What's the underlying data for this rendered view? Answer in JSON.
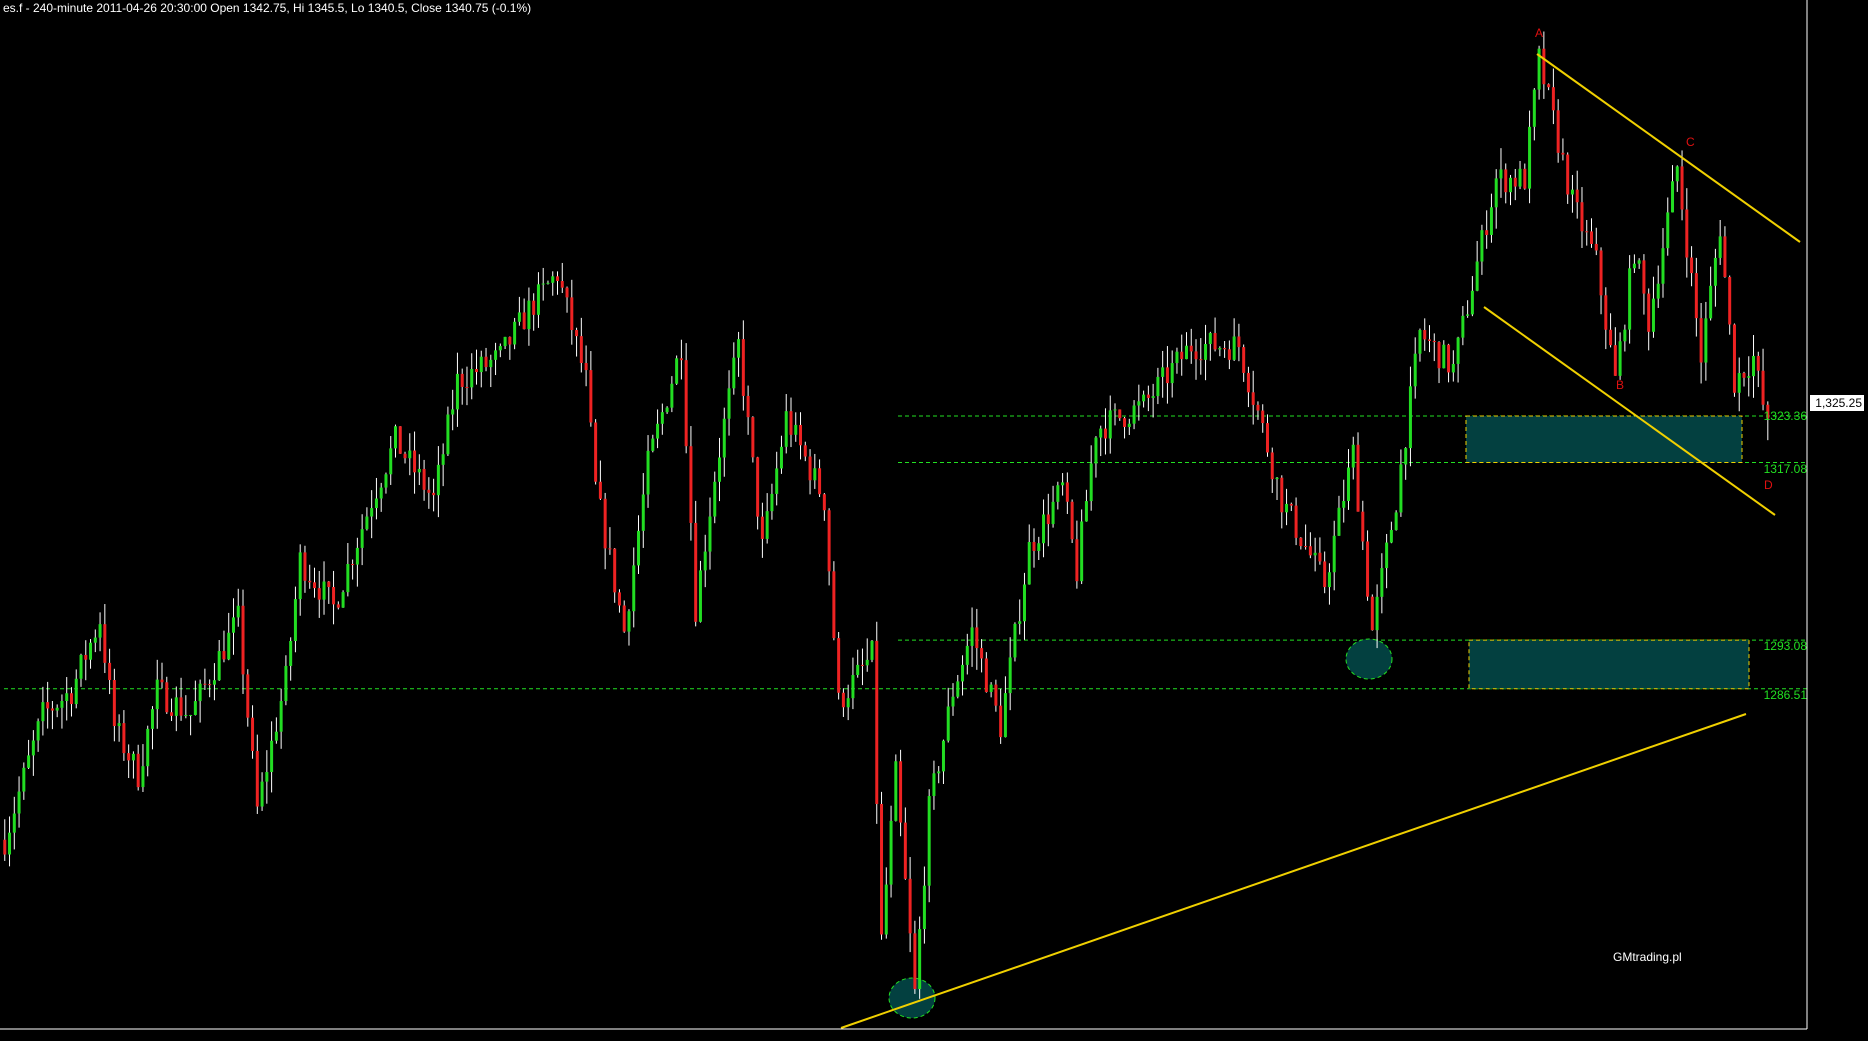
{
  "header": {
    "title": "es.f - 240-minute 2011-04-26 20:30:00 Open 1342.75, Hi 1345.5, Lo 1340.5, Close 1340.75 (-0.1%)"
  },
  "watermark": "GMtrading.pl",
  "last_price": "1,325.25",
  "colors": {
    "up": "#22dd22",
    "down": "#ee2222",
    "wick": "#ffffff",
    "trendline": "#f0d000",
    "level": "#22e022",
    "zone": "#034040"
  },
  "chart_data": {
    "type": "candlestick",
    "symbol": "es.f",
    "interval": "240-minute",
    "ylim": [
      1244,
      1373
    ],
    "levels": [
      {
        "label": "1323.36",
        "value": 1323.36
      },
      {
        "label": "1317.08",
        "value": 1317.08
      },
      {
        "label": "1293.08",
        "value": 1293.08
      },
      {
        "label": "1286.51",
        "value": 1286.51
      }
    ],
    "wave_labels": [
      {
        "text": "A",
        "bar": 323,
        "price": 1375
      },
      {
        "text": "B",
        "bar": 340,
        "price": 1323
      },
      {
        "text": "C",
        "bar": 355,
        "price": 1361
      },
      {
        "text": "D",
        "bar": 371,
        "price": 1310
      }
    ],
    "path": [
      [
        1,
        1266.1
      ],
      [
        9,
        1283
      ],
      [
        15,
        1286.2
      ],
      [
        21,
        1295.9
      ],
      [
        24,
        1281.4
      ],
      [
        29,
        1274.9
      ],
      [
        33,
        1286.2
      ],
      [
        40,
        1283
      ],
      [
        50,
        1295.9
      ],
      [
        54,
        1270.1
      ],
      [
        60,
        1287.8
      ],
      [
        63,
        1303.9
      ],
      [
        70,
        1297.5
      ],
      [
        78,
        1312
      ],
      [
        83,
        1320
      ],
      [
        91,
        1312
      ],
      [
        96,
        1328.1
      ],
      [
        105,
        1331.3
      ],
      [
        111,
        1337.7
      ],
      [
        117,
        1342.6
      ],
      [
        123,
        1328.1
      ],
      [
        125,
        1313.6
      ],
      [
        131,
        1294.3
      ],
      [
        136,
        1316.8
      ],
      [
        143,
        1332.9
      ],
      [
        146,
        1297.5
      ],
      [
        150,
        1315.2
      ],
      [
        155,
        1332.9
      ],
      [
        160,
        1305.5
      ],
      [
        165,
        1323.2
      ],
      [
        173,
        1312
      ],
      [
        176,
        1284.6
      ],
      [
        183,
        1291
      ],
      [
        185,
        1252.4
      ],
      [
        188,
        1274.9
      ],
      [
        192,
        1245.2
      ],
      [
        195,
        1270.1
      ],
      [
        200,
        1286.2
      ],
      [
        204,
        1294.3
      ],
      [
        210,
        1281.4
      ],
      [
        216,
        1305.5
      ],
      [
        223,
        1313.6
      ],
      [
        226,
        1302.3
      ],
      [
        230,
        1321.6
      ],
      [
        240,
        1324.8
      ],
      [
        250,
        1332.9
      ],
      [
        260,
        1332.9
      ],
      [
        265,
        1321.6
      ],
      [
        269,
        1312
      ],
      [
        278,
        1300.7
      ],
      [
        284,
        1318.4
      ],
      [
        288,
        1294.3
      ],
      [
        293,
        1312
      ],
      [
        298,
        1334.5
      ],
      [
        305,
        1329.7
      ],
      [
        314,
        1355.4
      ],
      [
        320,
        1355.4
      ],
      [
        323,
        1371.5
      ],
      [
        330,
        1352.2
      ],
      [
        335,
        1344.2
      ],
      [
        339,
        1328.1
      ],
      [
        343,
        1345.8
      ],
      [
        346,
        1336.1
      ],
      [
        352,
        1357
      ],
      [
        357,
        1331.3
      ],
      [
        361,
        1349
      ],
      [
        364,
        1328.1
      ],
      [
        368,
        1331.3
      ],
      [
        371,
        1321.6
      ]
    ]
  }
}
